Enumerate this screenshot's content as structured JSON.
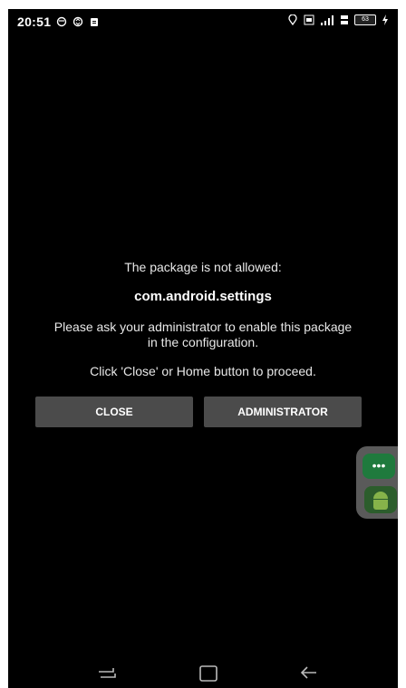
{
  "status_bar": {
    "time": "20:51",
    "battery": "63"
  },
  "dialog": {
    "line1": "The package is not allowed:",
    "package": "com.android.settings",
    "line3a": "Please ask your administrator to enable this package",
    "line3b": "in the configuration.",
    "line4": "Click 'Close' or Home button to proceed."
  },
  "buttons": {
    "close": "CLOSE",
    "administrator": "ADMINISTRATOR"
  },
  "floating": {
    "more_label": "•••"
  },
  "icons": {
    "status_left": [
      "alarm-icon",
      "sync-icon",
      "notification-icon"
    ],
    "status_right": [
      "location-icon",
      "volte-icon",
      "signal-icon",
      "lte-icon",
      "battery-icon",
      "charging-icon"
    ],
    "navbar": [
      "recent-apps-icon",
      "home-icon",
      "back-icon"
    ]
  }
}
